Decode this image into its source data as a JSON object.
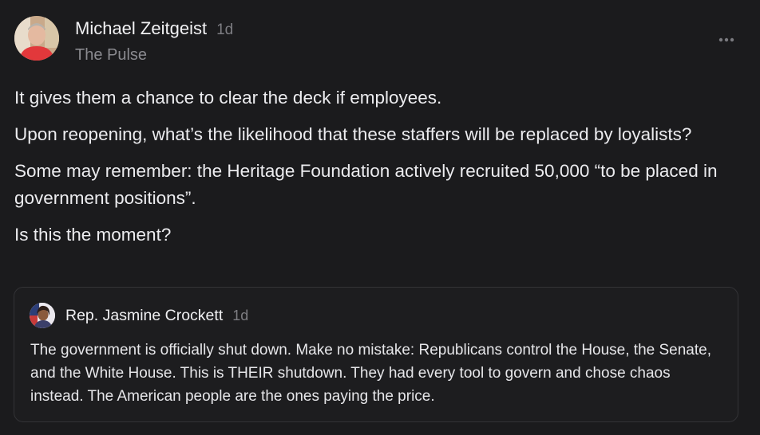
{
  "post": {
    "author": "Michael Zeitgeist",
    "timestamp": "1d",
    "publication": "The Pulse",
    "paragraphs": [
      "It gives them a chance to clear the deck if employees.",
      "Upon reopening, what’s the likelihood that these staffers will be replaced by loyalists?",
      "Some may remember: the Heritage Foundation actively recruited 50,000 “to be placed in government positions”.",
      "Is this the moment?"
    ]
  },
  "quote": {
    "author": "Rep. Jasmine Crockett",
    "timestamp": "1d",
    "text": "The government is officially shut down. Make no mistake: Republicans control the House, the Senate, and the White House. This is THEIR shutdown. They had every tool to govern and chose chaos instead. The American people are the ones paying the price."
  },
  "icons": {
    "more": "more-horizontal-icon",
    "author_avatar": "avatar",
    "quote_avatar": "avatar"
  },
  "colors": {
    "background": "#1b1b1d",
    "text_primary": "#ececef",
    "text_muted": "#8a8a8f",
    "card_border": "#333336"
  }
}
